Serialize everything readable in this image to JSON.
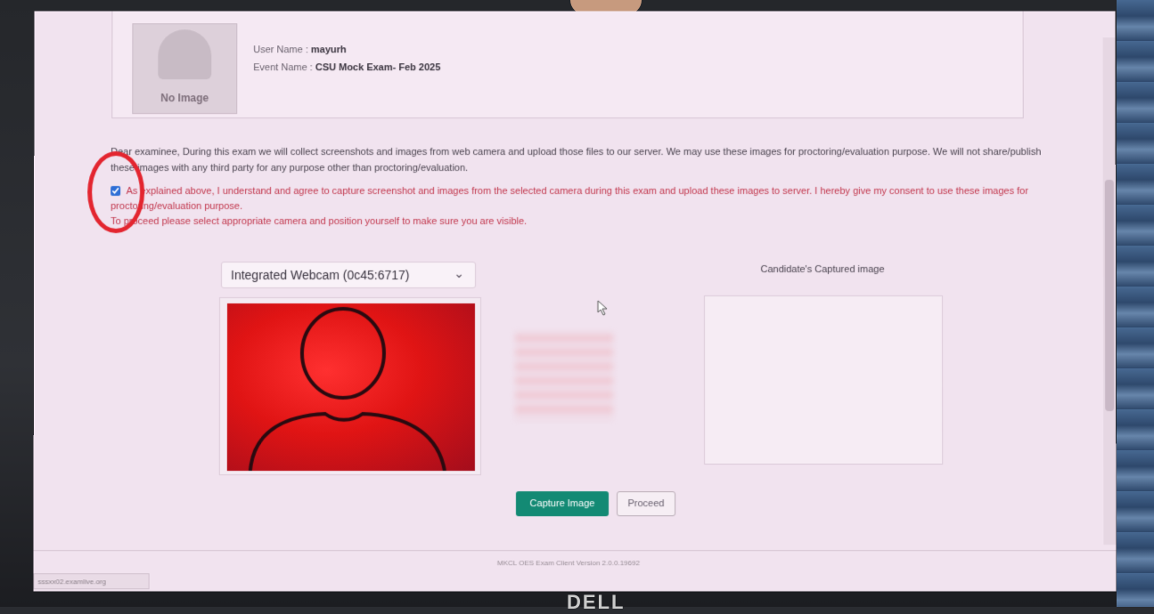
{
  "profile": {
    "no_image_label": "No Image",
    "user_name_label": "User Name :",
    "user_name": "mayurh",
    "event_name_label": "Event Name :",
    "event_name": "CSU Mock Exam- Feb 2025"
  },
  "notice": {
    "text": "Dear examinee, During this exam we will collect screenshots and images from web camera and upload those files to our server. We may use these images for proctoring/evaluation purpose. We will not share/publish these images with any third party for any purpose other than proctoring/evaluation."
  },
  "consent": {
    "checked": true,
    "text": "As explained above, I understand and agree to capture screenshot and images from the selected camera during this exam and upload these images to server. I hereby give my consent to use these images for proctoring/evaluation purpose.",
    "instruction": "To proceed please select appropriate camera and position yourself to make sure you are visible."
  },
  "camera": {
    "selected": "Integrated Webcam (0c45:6717)"
  },
  "captured": {
    "title": "Candidate's Captured image"
  },
  "buttons": {
    "capture": "Capture Image",
    "proceed": "Proceed"
  },
  "footer": {
    "version": "MKCL OES Exam Client Version 2.0.0.19692",
    "url": "sssxx02.examlive.org"
  },
  "device": {
    "brand": "DELL"
  },
  "colors": {
    "accent": "#138a74",
    "consent_text": "#c2384e",
    "annotation": "#e32630",
    "webcam_bg": "#e01414"
  }
}
